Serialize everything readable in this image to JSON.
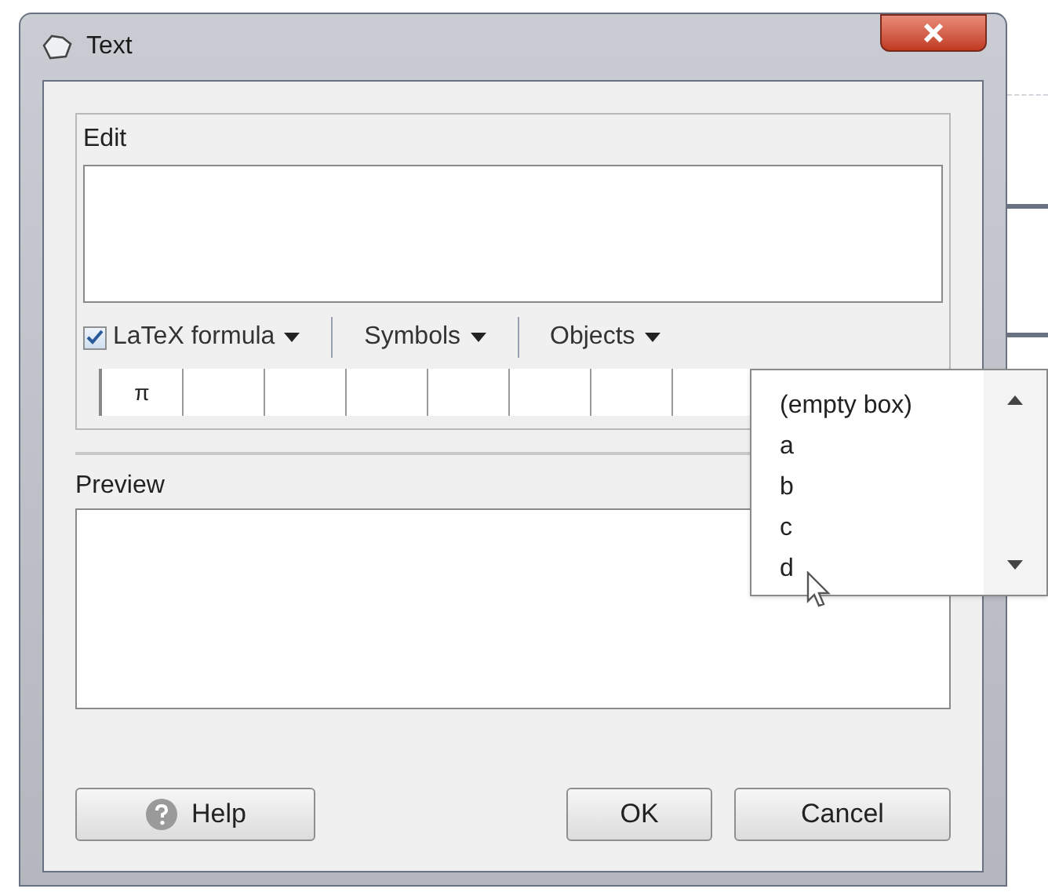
{
  "window": {
    "title": "Text"
  },
  "edit": {
    "label": "Edit"
  },
  "toolbar": {
    "latex": {
      "label": "LaTeX formula",
      "checked": true
    },
    "menus": [
      "Symbols",
      "Objects"
    ]
  },
  "symbols": [
    "π"
  ],
  "objects_menu": {
    "items": [
      "(empty box)",
      "a",
      "b",
      "c",
      "d"
    ]
  },
  "preview": {
    "label": "Preview"
  },
  "buttons": {
    "help": "Help",
    "ok": "OK",
    "cancel": "Cancel"
  }
}
